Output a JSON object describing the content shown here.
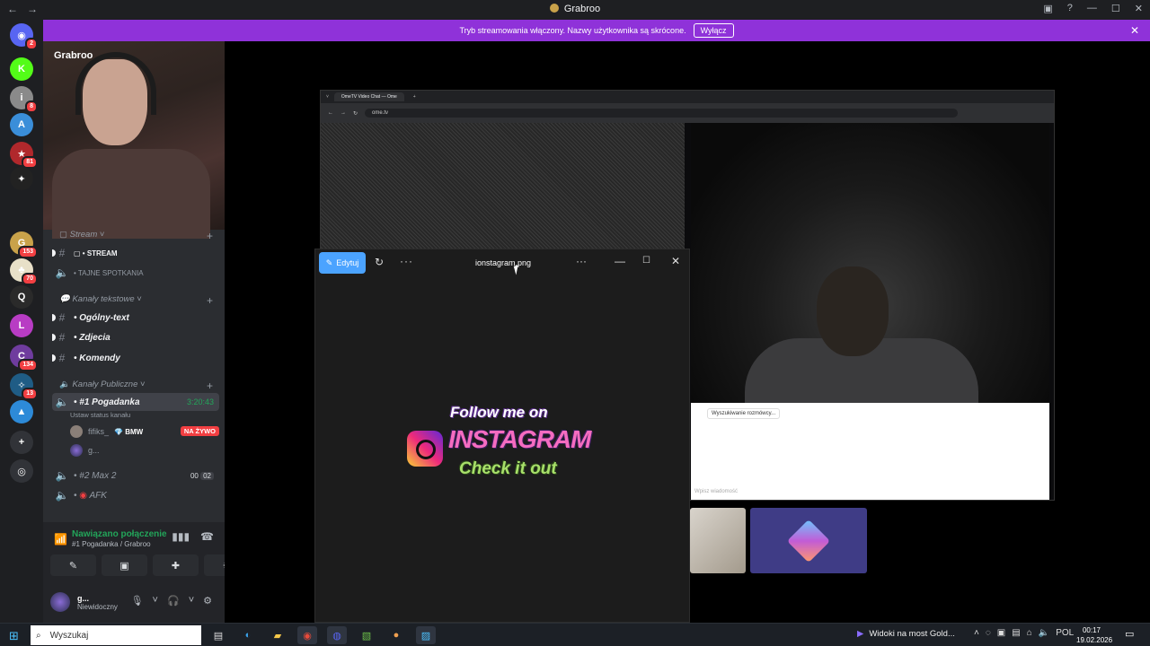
{
  "window": {
    "title": "Grabroo",
    "nav_back": "←",
    "nav_forward": "→",
    "controls": [
      "▣",
      "?",
      "—",
      "☐",
      "✕"
    ]
  },
  "banner": {
    "text": "Tryb streamowania włączony. Nazwy użytkownika są skrócone.",
    "button": "Wyłącz",
    "close": "✕"
  },
  "rail": {
    "servers": [
      {
        "glyph": "◉",
        "color": "#5865f2",
        "badge": "2"
      },
      {
        "glyph": "K",
        "color": "#53fc18",
        "badge": ""
      },
      {
        "glyph": "i",
        "color": "#8a8a8a",
        "badge": "8"
      },
      {
        "glyph": "A",
        "color": "#3a8ed9",
        "badge": ""
      },
      {
        "glyph": "★",
        "color": "#b0282c",
        "badge": "81"
      },
      {
        "glyph": "✦",
        "color": "#222",
        "badge": ""
      },
      {
        "glyph": "G",
        "color": "#c9a24a",
        "badge": "153"
      },
      {
        "glyph": "♣",
        "color": "#e8e0c8",
        "badge": "70"
      },
      {
        "glyph": "Q",
        "color": "#2a2a2a",
        "badge": ""
      },
      {
        "glyph": "L",
        "color": "#b83cc4",
        "badge": ""
      },
      {
        "glyph": "C",
        "color": "#6f3c9e",
        "badge": "134"
      },
      {
        "glyph": "✧",
        "color": "#1f5c85",
        "badge": "13"
      },
      {
        "glyph": "▲",
        "color": "#2d8ad8",
        "badge": ""
      },
      {
        "glyph": "+",
        "color": "#313338",
        "badge": ""
      },
      {
        "glyph": "◎",
        "color": "#313338",
        "badge": ""
      }
    ]
  },
  "sidebar": {
    "server_name": "Grabroo",
    "categories": {
      "stream": "Stream",
      "text": "Kanały tekstowe",
      "public": "Kanały Publiczne",
      "plus": "+"
    },
    "stream_channels": [
      {
        "sym": "#",
        "name": "STREAM"
      },
      {
        "sym": "🔈",
        "name": "TAJNE SPOTKANIA"
      }
    ],
    "text_channels": [
      {
        "sym": "#",
        "name": "Ogólny-text"
      },
      {
        "sym": "#",
        "name": "Zdjecia"
      },
      {
        "sym": "#",
        "name": "Komendy"
      }
    ],
    "voice_channels": [
      {
        "name": "#1 Pogadanka",
        "timer": "3:20:43",
        "status_hint": "Ustaw status kanału"
      },
      {
        "name": "#2 Max 2",
        "count_a": "00",
        "count_b": "02"
      },
      {
        "name": "AFK"
      }
    ],
    "voice_users": [
      {
        "name": "fifiks_",
        "tag": "BMW",
        "live": "NA ŻYWO"
      },
      {
        "name": "g..."
      }
    ],
    "voice_panel": {
      "title": "Nawiązano połączenie",
      "subtitle": "#1 Pogadanka / Grabroo",
      "icons": [
        "▮▮▮",
        "☎"
      ],
      "buttons": [
        "✎",
        "▣",
        "✚",
        "✸"
      ]
    },
    "me": {
      "name": "g...",
      "status": "Niewidoczny",
      "controls": [
        "🎙",
        "˅",
        "🎧",
        "˅",
        "⚙"
      ]
    }
  },
  "browser": {
    "tab_label": "OmeTV Video Chat — Ome",
    "url": "ome.tv",
    "searching": "Wyszukiwanie rozmówcy...",
    "input_hint": "Wpisz wiadomość"
  },
  "photos": {
    "edit_label": "Edytuj",
    "filename": "ionstagram.png",
    "image_text": {
      "follow": "Follow me on",
      "instagram": "INSTAGRAM",
      "check": "Check it out"
    }
  },
  "taskbar": {
    "search_placeholder": "Wyszukaj",
    "media_title": "Widoki na most Gold...",
    "lang": "POL",
    "time": "00:17",
    "date": "19.02.2026"
  }
}
